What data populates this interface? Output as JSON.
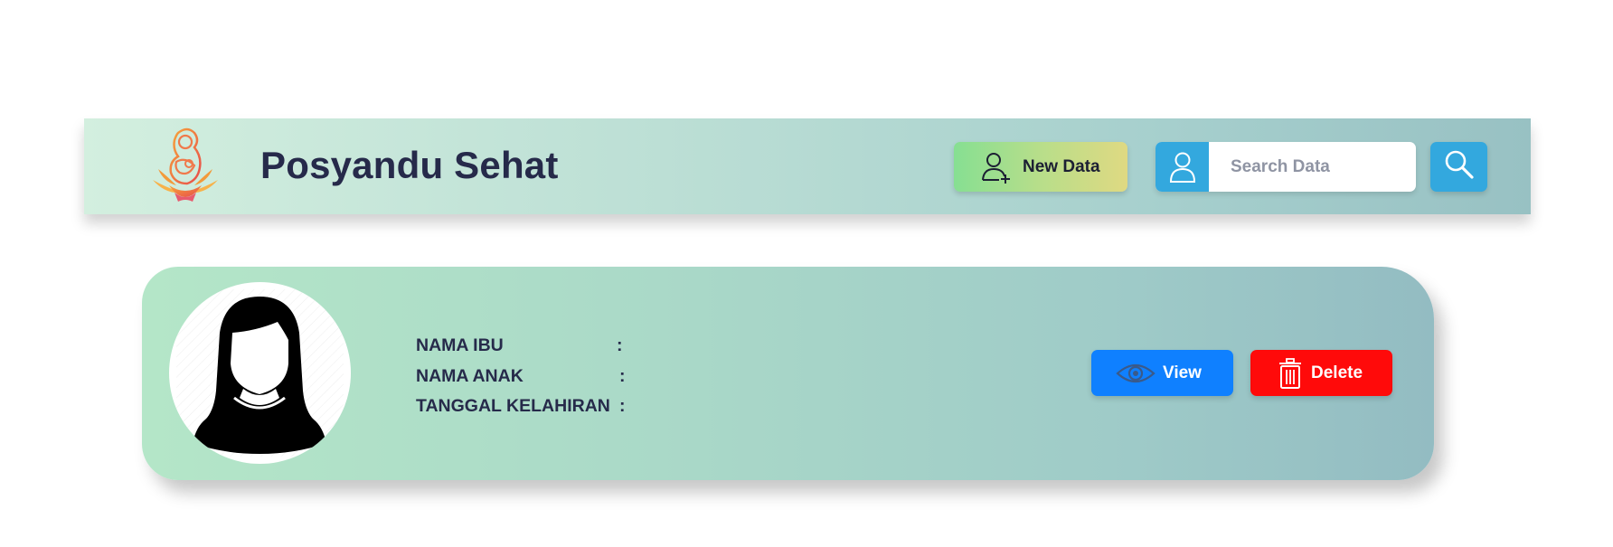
{
  "header": {
    "logo_icon": "mother-child-logo",
    "title": "Posyandu Sehat",
    "new_data_label": "New Data",
    "new_data_icon": "add-user-icon",
    "search": {
      "user_icon": "user-icon",
      "placeholder": "Search Data",
      "value": "",
      "button_icon": "search-icon"
    }
  },
  "record_card": {
    "avatar_icon": "female-avatar-icon",
    "fields": [
      {
        "label": "NAMA IBU",
        "separator": ":",
        "value": ""
      },
      {
        "label": "NAMA ANAK",
        "separator": ":",
        "value": ""
      },
      {
        "label": "TANGGAL KELAHIRAN",
        "separator": ":",
        "value": ""
      }
    ],
    "view_label": "View",
    "view_icon": "eye-icon",
    "delete_label": "Delete",
    "delete_icon": "trash-icon"
  },
  "colors": {
    "title_text": "#262a4a",
    "search_accent": "#33a8de",
    "view_button": "#0f80ff",
    "delete_button": "#ff0a0a"
  }
}
